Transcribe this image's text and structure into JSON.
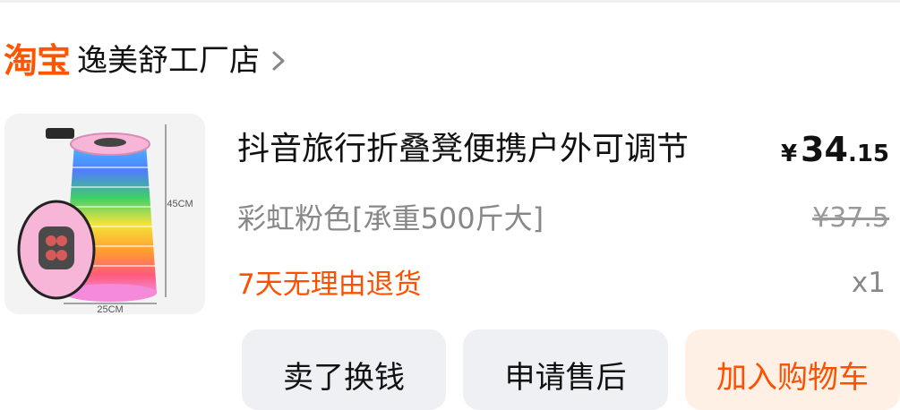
{
  "shop": {
    "platform_logo": "淘宝",
    "name": "逸美舒工厂店",
    "chevron_icon": "chevron-right-icon"
  },
  "product": {
    "image_icon": "rainbow-folding-stool-image",
    "title": "抖音旅行折叠凳便携户外可调节",
    "sku": "彩虹粉色[承重500斤大]",
    "price_symbol": "¥",
    "price_integer": "34",
    "price_decimal": ".15",
    "original_price": "¥37.5",
    "service_tag": "7天无理由退货",
    "quantity": "x1"
  },
  "actions": {
    "sell_label": "卖了换钱",
    "after_sale_label": "申请售后",
    "add_to_cart_label": "加入购物车"
  },
  "colors": {
    "brand_orange": "#ff5000",
    "button_gray": "#eef0f3",
    "button_cart_bg": "#fff0e6"
  }
}
